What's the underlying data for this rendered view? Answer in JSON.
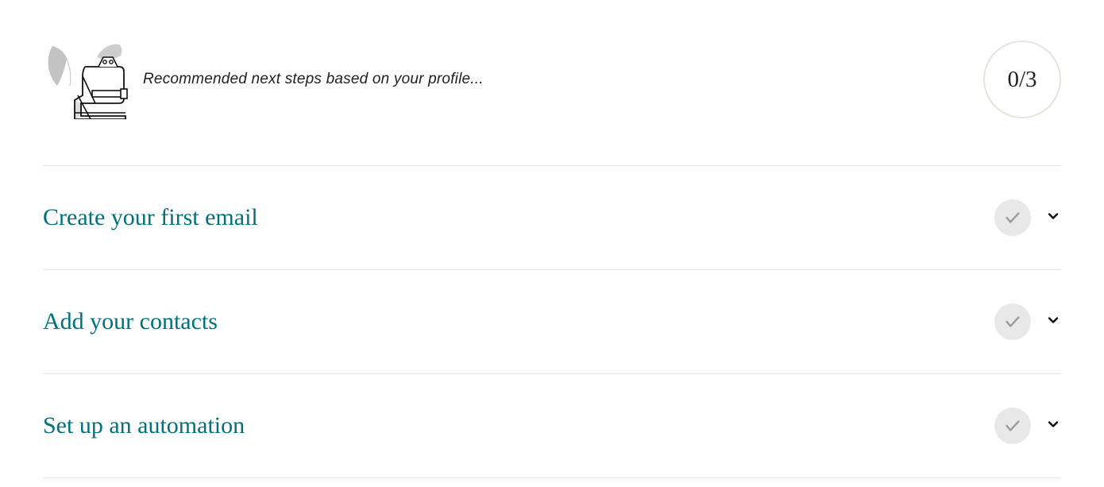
{
  "header": {
    "subtitle": "Recommended next steps based on your profile...",
    "progress": "0/3"
  },
  "steps": [
    {
      "title": "Create your first email"
    },
    {
      "title": "Add your contacts"
    },
    {
      "title": "Set up an automation"
    }
  ]
}
